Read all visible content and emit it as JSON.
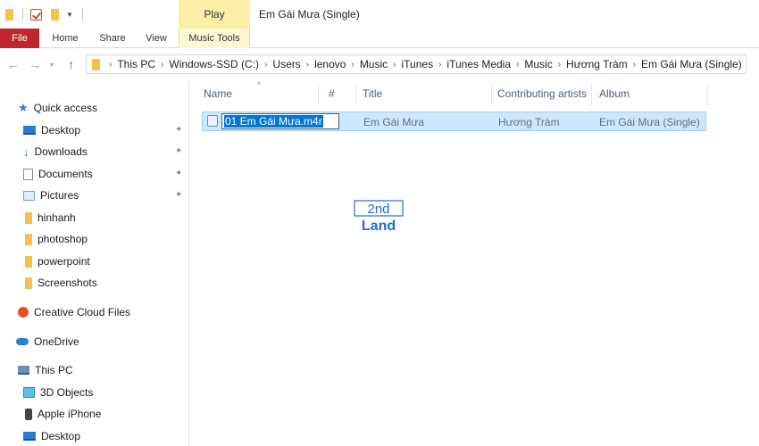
{
  "window": {
    "title": "Em Gái Mưa (Single)",
    "context_tab": "Play"
  },
  "ribbon": {
    "tabs": [
      "File",
      "Home",
      "Share",
      "View",
      "Music Tools"
    ],
    "accent": "#c0262d",
    "context_color": "#fbefa7"
  },
  "address": {
    "crumbs": [
      "This PC",
      "Windows-SSD (C:)",
      "Users",
      "lenovo",
      "Music",
      "iTunes",
      "iTunes Media",
      "Music",
      "Hương Tràm",
      "Em Gái Mưa (Single)"
    ]
  },
  "navpane": {
    "quick_access": "Quick access",
    "items": [
      {
        "label": "Desktop",
        "icon": "desktop-icon",
        "pinned": true
      },
      {
        "label": "Downloads",
        "icon": "download-icon",
        "pinned": true
      },
      {
        "label": "Documents",
        "icon": "documents-icon",
        "pinned": true
      },
      {
        "label": "Pictures",
        "icon": "pictures-icon",
        "pinned": true
      },
      {
        "label": "hinhanh",
        "icon": "folder-icon",
        "pinned": false
      },
      {
        "label": "photoshop",
        "icon": "folder-icon",
        "pinned": false
      },
      {
        "label": "powerpoint",
        "icon": "folder-icon",
        "pinned": false
      },
      {
        "label": "Screenshots",
        "icon": "folder-icon",
        "pinned": false
      }
    ],
    "creative_cloud": "Creative Cloud Files",
    "onedrive": "OneDrive",
    "this_pc": "This PC",
    "pc_items": [
      {
        "label": "3D Objects",
        "icon": "3d-objects-icon"
      },
      {
        "label": "Apple iPhone",
        "icon": "phone-icon"
      },
      {
        "label": "Desktop",
        "icon": "desktop-icon"
      }
    ]
  },
  "columns": {
    "name": "Name",
    "number": "#",
    "title": "Title",
    "artists": "Contributing artists",
    "album": "Album"
  },
  "files": [
    {
      "name_editing": "01 Em Gái Mưa.m4r",
      "title": "Em Gái Mưa",
      "artists": "Hương Tràm",
      "album": "Em Gái Mưa (Single)"
    }
  ],
  "watermark": {
    "line1": "2nd",
    "line2": "Land"
  }
}
